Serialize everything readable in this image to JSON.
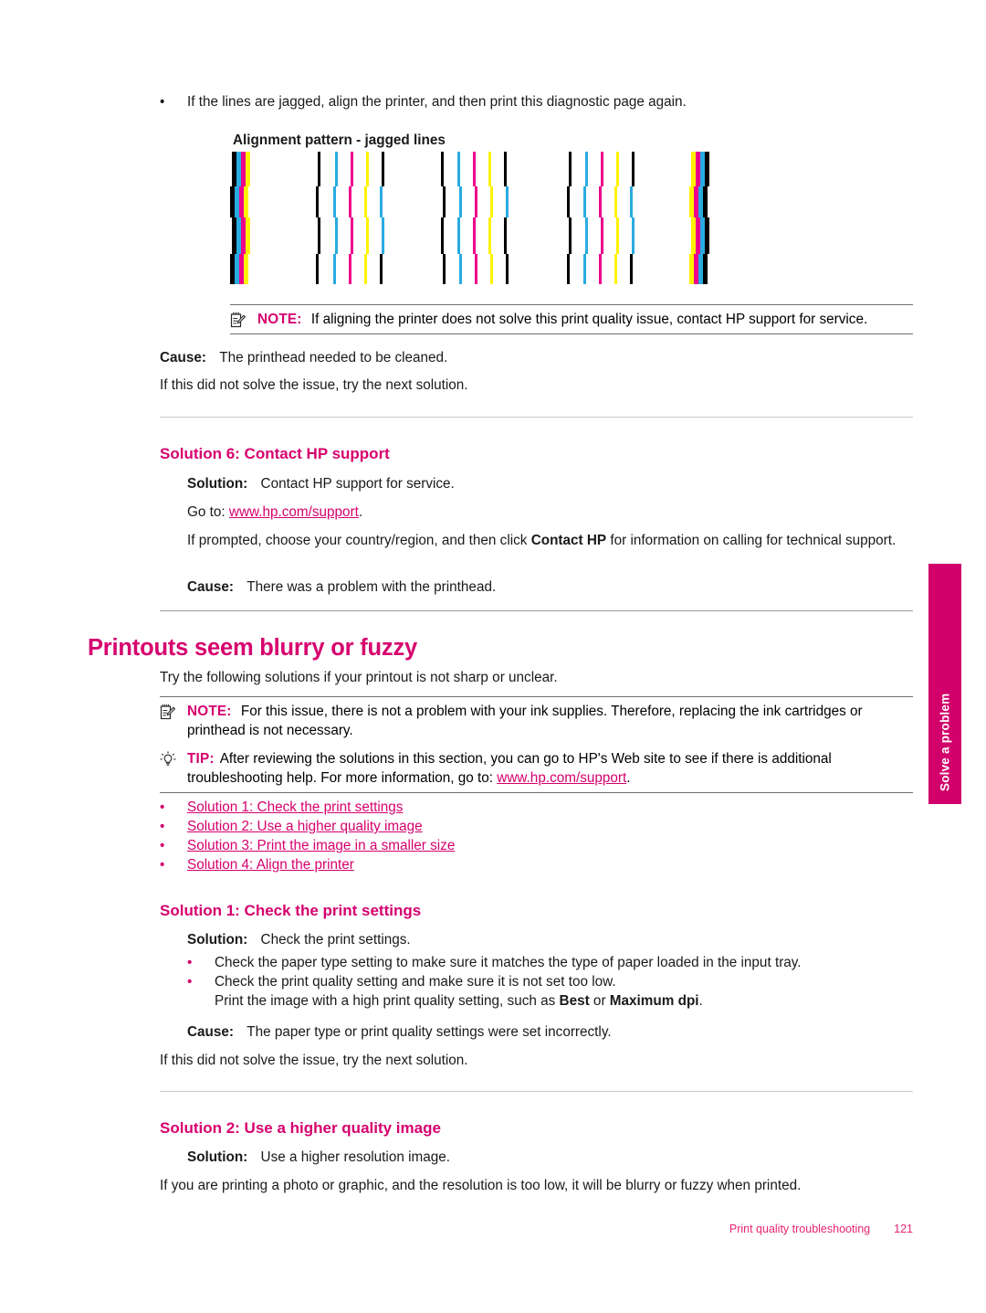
{
  "page": {
    "footer_title": "Print quality troubleshooting",
    "page_number": "121",
    "side_tab_label": "Solve a problem",
    "accent_color": "#d6006e",
    "side_tab_color": "#d1006a"
  },
  "top_section": {
    "bullet": {
      "marker": "•",
      "text": "If the lines are jagged, align the printer, and then print this diagnostic page again."
    },
    "figure_caption": "Alignment pattern - jagged lines",
    "figure": {
      "icon_name": "alignment-pattern-image",
      "colors": [
        "#000000",
        "#29abe2",
        "#ec008c",
        "#fff200"
      ]
    },
    "note": {
      "icon_name": "note-icon",
      "label": "NOTE:",
      "text": "If aligning the printer does not solve this print quality issue, contact HP support for service."
    },
    "cause_label": "Cause:",
    "cause_text": "The printhead needed to be cleaned.",
    "next_solution_text": "If this did not solve the issue, try the next solution."
  },
  "solution6": {
    "title": "Solution 6: Contact HP support",
    "solution_label": "Solution:",
    "solution_text": "Contact HP support for service.",
    "goto_prefix": "Go to: ",
    "goto_link": "www.hp.com/support",
    "goto_suffix": ".",
    "prompt_text_1": "If prompted, choose your country/region, and then click ",
    "prompt_bold": "Contact HP",
    "prompt_text_2": " for information on calling for technical support.",
    "cause_label": "Cause:",
    "cause_text": "There was a problem with the printhead."
  },
  "main_section": {
    "title": "Printouts seem blurry or fuzzy",
    "intro": "Try the following solutions if your printout is not sharp or unclear.",
    "note": {
      "icon_name": "note-icon",
      "label": "NOTE:",
      "text": "For this issue, there is not a problem with your ink supplies. Therefore, replacing the ink cartridges or printhead is not necessary."
    },
    "tip": {
      "icon_name": "lightbulb-icon",
      "label": "TIP:",
      "text_1": "After reviewing the solutions in this section, you can go to HP's Web site to see if there is additional troubleshooting help. For more information, go to: ",
      "link": "www.hp.com/support",
      "text_2": "."
    },
    "links": [
      {
        "marker": "•",
        "label": "Solution 1: Check the print settings"
      },
      {
        "marker": "•",
        "label": "Solution 2: Use a higher quality image"
      },
      {
        "marker": "•",
        "label": "Solution 3: Print the image in a smaller size"
      },
      {
        "marker": "•",
        "label": "Solution 4: Align the printer"
      }
    ]
  },
  "solution1": {
    "title": "Solution 1: Check the print settings",
    "solution_label": "Solution:",
    "solution_text": "Check the print settings.",
    "bullets": [
      {
        "marker": "•",
        "text": "Check the paper type setting to make sure it matches the type of paper loaded in the input tray."
      },
      {
        "marker": "•",
        "text": "Check the print quality setting and make sure it is not set too low."
      }
    ],
    "bullet2_extra_1": "Print the image with a high print quality setting, such as ",
    "bullet2_bold_1": "Best",
    "bullet2_extra_2": " or ",
    "bullet2_bold_2": "Maximum dpi",
    "bullet2_extra_3": ".",
    "cause_label": "Cause:",
    "cause_text": "The paper type or print quality settings were set incorrectly.",
    "next_solution_text": "If this did not solve the issue, try the next solution."
  },
  "solution2": {
    "title": "Solution 2: Use a higher quality image",
    "solution_label": "Solution:",
    "solution_text": "Use a higher resolution image.",
    "body_text": "If you are printing a photo or graphic, and the resolution is too low, it will be blurry or fuzzy when printed."
  }
}
